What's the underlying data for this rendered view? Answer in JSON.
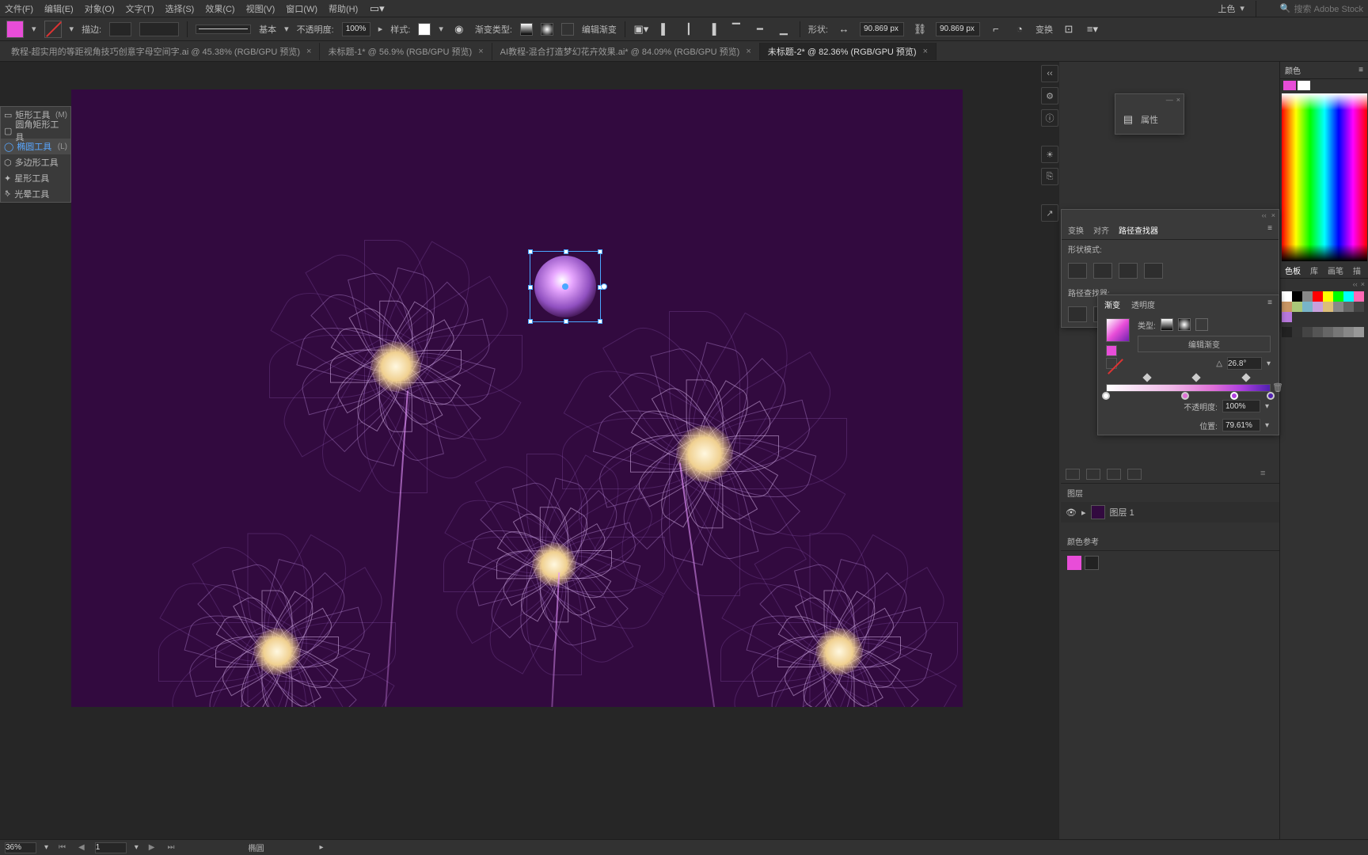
{
  "menu": {
    "file": "文件(F)",
    "edit": "编辑(E)",
    "object": "对象(O)",
    "type": "文字(T)",
    "select": "选择(S)",
    "effect": "效果(C)",
    "view": "视图(V)",
    "window": "窗口(W)",
    "help": "帮助(H)",
    "upcolor": "上色",
    "search_ph": "搜索 Adobe Stock"
  },
  "opt": {
    "stroke": "描边:",
    "stroke_val": "",
    "basic": "基本",
    "opacity": "不透明度:",
    "opacity_val": "100%",
    "style": "样式:",
    "gradtype": "渐变类型:",
    "editgrad": "编辑渐变",
    "shape": "形状:",
    "w": "90.869 px",
    "h": "90.869 px",
    "transform": "变换"
  },
  "tabs": [
    {
      "label": "教程-超实用的等距视角技巧创意字母空间字.ai @ 45.38% (RGB/GPU 预览)",
      "active": false
    },
    {
      "label": "未标题-1* @ 56.9% (RGB/GPU 预览)",
      "active": false
    },
    {
      "label": "AI教程-混合打造梦幻花卉效果.ai* @ 84.09% (RGB/GPU 预览)",
      "active": false
    },
    {
      "label": "未标题-2* @ 82.36% (RGB/GPU 预览)",
      "active": true
    }
  ],
  "toolfly": {
    "items": [
      {
        "name": "矩形工具",
        "key": "(M)",
        "sel": false
      },
      {
        "name": "圆角矩形工具",
        "key": "",
        "sel": false
      },
      {
        "name": "椭圆工具",
        "key": "(L)",
        "sel": true
      },
      {
        "name": "多边形工具",
        "key": "",
        "sel": false
      },
      {
        "name": "星形工具",
        "key": "",
        "sel": false
      },
      {
        "name": "光晕工具",
        "key": "",
        "sel": false
      }
    ]
  },
  "properties": {
    "label": "属性"
  },
  "pathfinder": {
    "t1": "变换",
    "t2": "对齐",
    "t3": "路径查找器",
    "shape_mode": "形状模式:",
    "pfinder": "路径查找器:"
  },
  "gradient": {
    "t1": "渐变",
    "t2": "透明度",
    "type": "类型:",
    "edit": "编辑渐变",
    "angle": "26.8°",
    "opacity_l": "不透明度:",
    "opacity_v": "100%",
    "pos_l": "位置:",
    "pos_v": "79.61%"
  },
  "color": {
    "title": "颜色"
  },
  "swatch_tabs": {
    "a": "色板",
    "b": "库",
    "c": "画笔",
    "d": "描"
  },
  "layers": {
    "title": "图层",
    "row": "图层 1"
  },
  "cguide": {
    "title": "颜色参考"
  },
  "status": {
    "zoom": "36%",
    "page": "1",
    "tool": "椭圆"
  }
}
